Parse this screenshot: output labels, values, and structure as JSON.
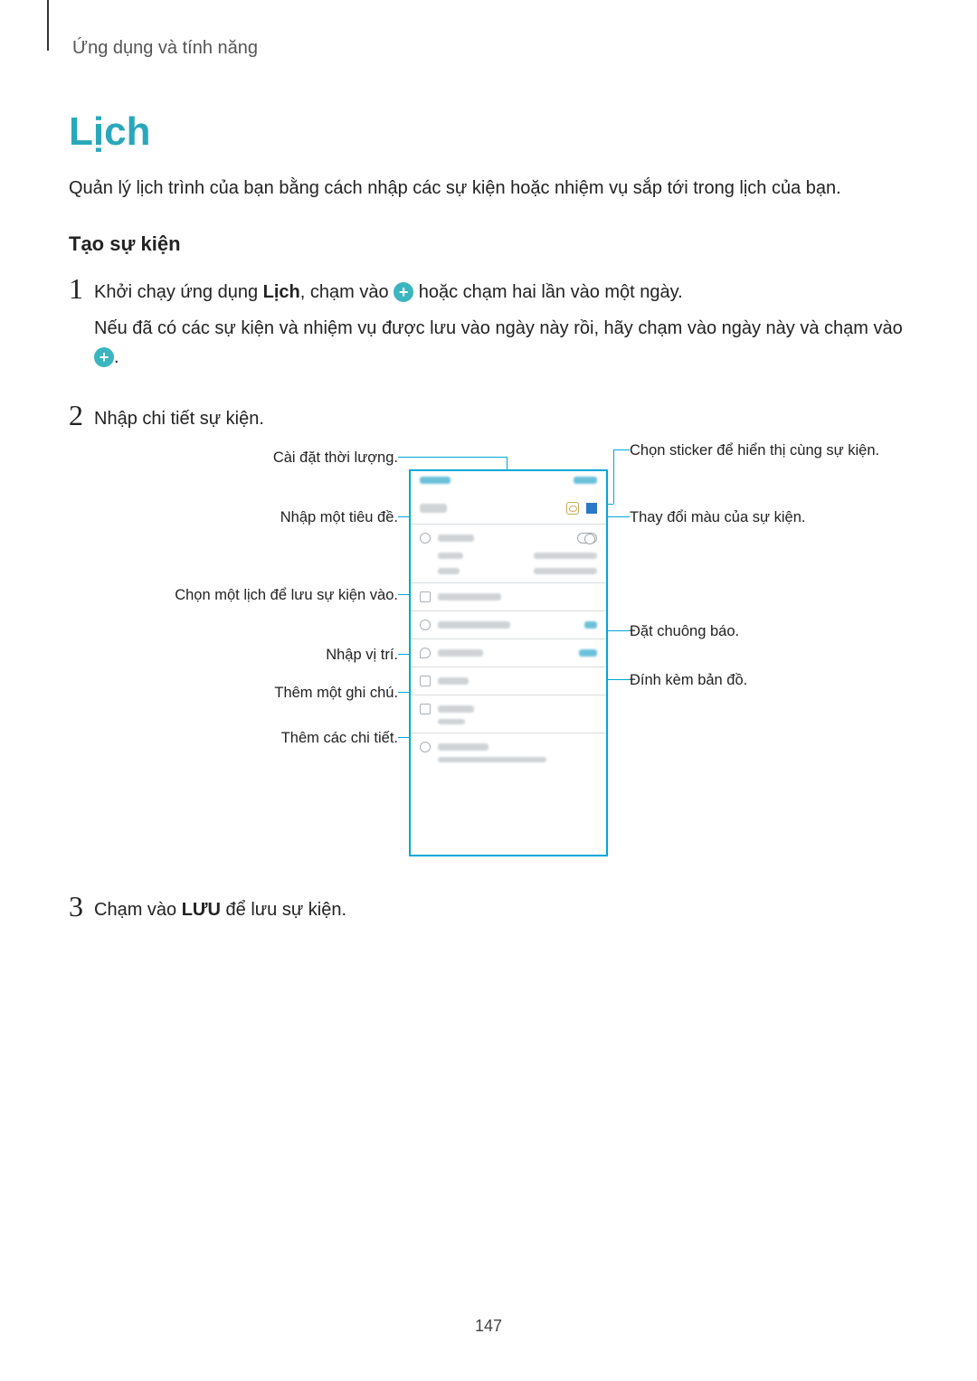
{
  "breadcrumb": "Ứng dụng và tính năng",
  "title": "Lịch",
  "intro": "Quản lý lịch trình của bạn bằng cách nhập các sự kiện hoặc nhiệm vụ sắp tới trong lịch của bạn.",
  "section": "Tạo sự kiện",
  "steps": {
    "s1a": "Khởi chạy ứng dụng ",
    "s1b": "Lịch",
    "s1c": ", chạm vào ",
    "s1d": " hoặc chạm hai lần vào một ngày.",
    "s1e": "Nếu đã có các sự kiện và nhiệm vụ được lưu vào ngày này rồi, hãy chạm vào ngày này và chạm vào ",
    "s2": "Nhập chi tiết sự kiện.",
    "s3a": "Chạm vào ",
    "s3b": "LƯU",
    "s3c": " để lưu sự kiện."
  },
  "callouts": {
    "duration": "Cài đặt thời lượng.",
    "titleInput": "Nhập một tiêu đề.",
    "calendar": "Chọn một lịch để lưu sự kiện vào.",
    "location": "Nhập vị trí.",
    "note": "Thêm một ghi chú.",
    "details": "Thêm các chi tiết.",
    "sticker": "Chọn sticker để hiển thị cùng sự kiện.",
    "color": "Thay đổi màu của sự kiện.",
    "alarm": "Đặt chuông báo.",
    "map": "Đính kèm bản đồ."
  },
  "pagenum": "147"
}
